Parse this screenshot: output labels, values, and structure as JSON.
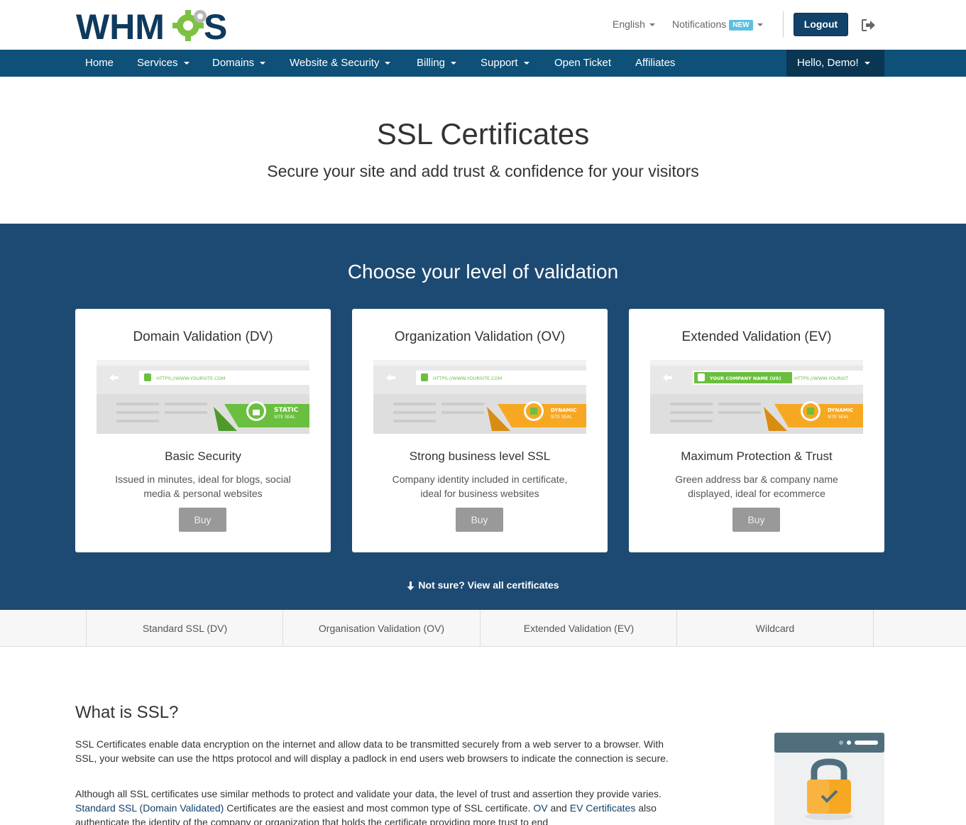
{
  "header": {
    "logo_text": "WHMCS",
    "language": "English",
    "notifications": "Notifications",
    "new_badge": "NEW",
    "logout": "Logout"
  },
  "nav": {
    "items": [
      "Home",
      "Services",
      "Domains",
      "Website & Security",
      "Billing",
      "Support",
      "Open Ticket",
      "Affiliates"
    ],
    "hello": "Hello, Demo!"
  },
  "hero": {
    "title": "SSL Certificates",
    "subtitle": "Secure your site and add trust & confidence for your visitors"
  },
  "validation": {
    "title": "Choose your level of validation",
    "cards": [
      {
        "title": "Domain Validation (DV)",
        "url_label": "HTTPS://WWW.YOURSITE.COM",
        "seal_line1": "STATIC",
        "seal_line2": "SITE SEAL",
        "subtitle": "Basic Security",
        "desc": "Issued in minutes, ideal for blogs, social media & personal websites",
        "buy": "Buy"
      },
      {
        "title": "Organization Validation (OV)",
        "url_label": "HTTPS://WWW.YOURSITE.COM",
        "seal_line1": "DYNAMIC",
        "seal_line2": "SITE SEAL",
        "subtitle": "Strong business level SSL",
        "desc": "Company identity included in certificate, ideal for business websites",
        "buy": "Buy"
      },
      {
        "title": "Extended Validation (EV)",
        "company_label": "YOUR COMPANY NAME (US)",
        "url_label": "HTTPS://WWW.YOURSIT",
        "seal_line1": "DYNAMIC",
        "seal_line2": "SITE SEAL",
        "subtitle": "Maximum Protection & Trust",
        "desc": "Green address bar & company name displayed, ideal for ecommerce",
        "buy": "Buy"
      }
    ],
    "not_sure": "Not sure? View all certificates"
  },
  "tabs": [
    "Standard SSL (DV)",
    "Organisation Validation (OV)",
    "Extended Validation (EV)",
    "Wildcard"
  ],
  "what_is_ssl": {
    "title": "What is SSL?",
    "para1": "SSL Certificates enable data encryption on the internet and allow data to be transmitted securely from a web server to a browser. With SSL, your website can use the https protocol and will display a padlock in end users web browsers to indicate the connection is secure.",
    "para2_a": "Although all SSL certificates use similar methods to protect and validate your data, the level of trust and assertion they provide varies. ",
    "para2_link1": "Standard SSL (Domain Validated)",
    "para2_b": " Certificates are the easiest and most common type of SSL certificate. ",
    "para2_link2": "OV",
    "para2_c": " and ",
    "para2_link3": "EV Certificates",
    "para2_d": " also authenticate the identity of the company or organization that holds the certificate providing more trust to end"
  },
  "colors": {
    "nav": "#0e5077",
    "band": "#1d4a72",
    "logout": "#11426a",
    "green": "#6bbf3f",
    "orange": "#f7a823",
    "new_badge": "#5bc0de"
  }
}
